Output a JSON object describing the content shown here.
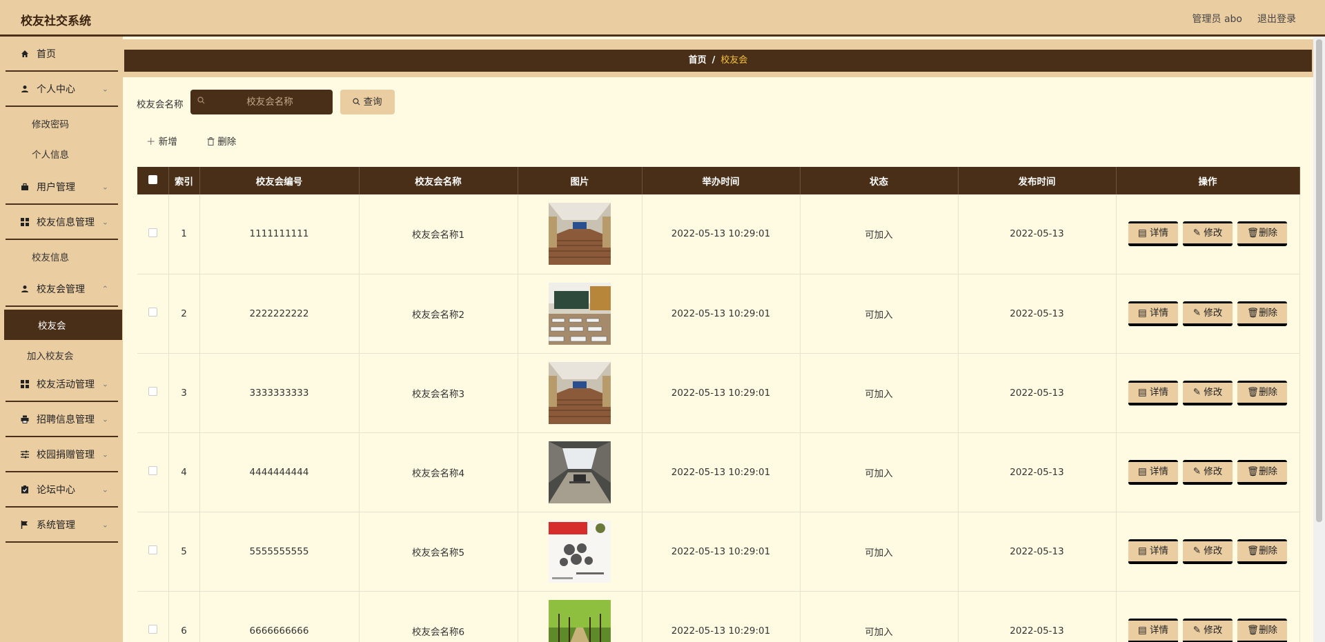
{
  "header": {
    "app_title": "校友社交系统",
    "admin_label": "管理员 abo",
    "logout_label": "退出登录"
  },
  "sidebar": {
    "home": "首页",
    "personal_center": "个人中心",
    "change_password": "修改密码",
    "personal_info": "个人信息",
    "user_mgmt": "用户管理",
    "alumni_info_mgmt": "校友信息管理",
    "alumni_info": "校友信息",
    "alumni_assoc_mgmt": "校友会管理",
    "alumni_assoc": "校友会",
    "join_alumni_assoc": "加入校友会",
    "alumni_activity_mgmt": "校友活动管理",
    "recruitment_mgmt": "招聘信息管理",
    "campus_donation_mgmt": "校园捐赠管理",
    "forum_center": "论坛中心",
    "system_mgmt": "系统管理"
  },
  "breadcrumb": {
    "home": "首页",
    "sep": "/",
    "current": "校友会"
  },
  "search": {
    "label": "校友会名称",
    "placeholder": "校友会名称",
    "query_button": "查询"
  },
  "toolbar": {
    "add_button": "新增",
    "delete_button": "删除"
  },
  "table": {
    "headers": [
      "索引",
      "校友会编号",
      "校友会名称",
      "图片",
      "举办时间",
      "状态",
      "发布时间",
      "操作"
    ],
    "rows": [
      {
        "index": "1",
        "code": "1111111111",
        "name": "校友会名称1",
        "time": "2022-05-13 10:29:01",
        "status": "可加入",
        "publish": "2022-05-13"
      },
      {
        "index": "2",
        "code": "2222222222",
        "name": "校友会名称2",
        "time": "2022-05-13 10:29:01",
        "status": "可加入",
        "publish": "2022-05-13"
      },
      {
        "index": "3",
        "code": "3333333333",
        "name": "校友会名称3",
        "time": "2022-05-13 10:29:01",
        "status": "可加入",
        "publish": "2022-05-13"
      },
      {
        "index": "4",
        "code": "4444444444",
        "name": "校友会名称4",
        "time": "2022-05-13 10:29:01",
        "status": "可加入",
        "publish": "2022-05-13"
      },
      {
        "index": "5",
        "code": "5555555555",
        "name": "校友会名称5",
        "time": "2022-05-13 10:29:01",
        "status": "可加入",
        "publish": "2022-05-13"
      },
      {
        "index": "6",
        "code": "6666666666",
        "name": "校友会名称6",
        "time": "2022-05-13 10:29:01",
        "status": "可加入",
        "publish": "2022-05-13"
      }
    ],
    "op_detail": "详情",
    "op_edit": "修改",
    "op_delete": "删除"
  },
  "colors": {
    "header_bg": "#ebcda2",
    "dark_brown": "#4a2f18",
    "page_bg": "#fffbe3",
    "breadcrumb_current": "#f5c33b"
  }
}
